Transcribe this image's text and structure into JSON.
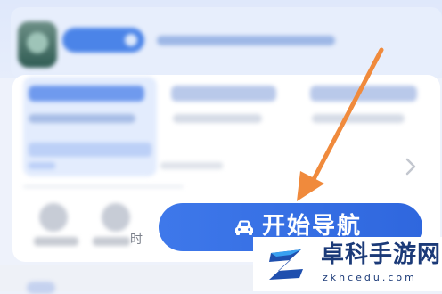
{
  "navigation": {
    "start_button_label": "开始导航",
    "tool_label_suffix": "时"
  },
  "icons": {
    "map_app": "map-app-icon",
    "chevron": "chevron-right-icon",
    "car": "car-icon",
    "arrow": "arrow-icon"
  },
  "colors": {
    "primary_button": "#3e78ea",
    "arrow": "#f08a3c",
    "background": "#eef2fb"
  },
  "watermark": {
    "title": "卓科手游网",
    "url": "zkhcedu.com"
  }
}
